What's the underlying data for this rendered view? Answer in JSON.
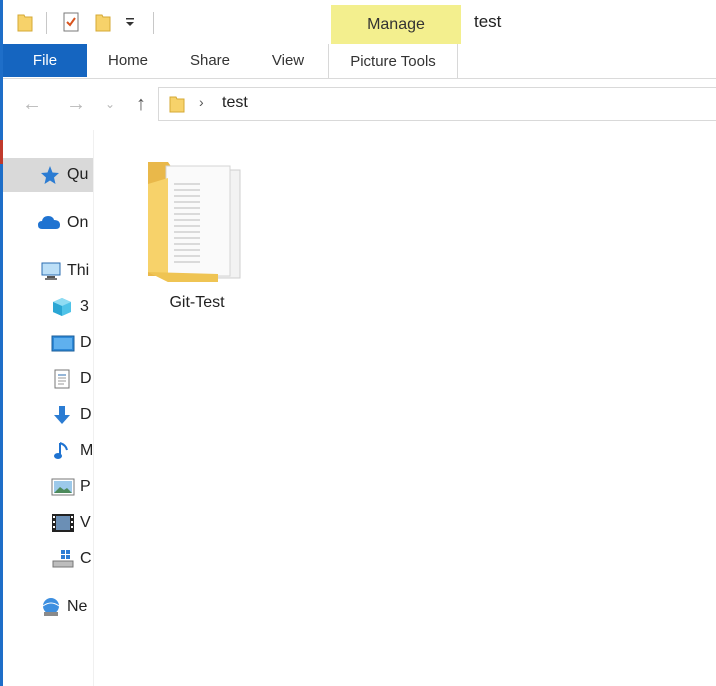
{
  "window": {
    "title": "test"
  },
  "quick_access_toolbar": {
    "items": [
      "folder-icon",
      "properties-icon",
      "new-folder-icon",
      "customize-dropdown-icon"
    ]
  },
  "ribbon": {
    "context_tab": "Manage",
    "tabs": [
      {
        "label": "File"
      },
      {
        "label": "Home"
      },
      {
        "label": "Share"
      },
      {
        "label": "View"
      },
      {
        "label": "Picture Tools"
      }
    ]
  },
  "address_bar": {
    "path": [
      "test"
    ]
  },
  "nav_pane": {
    "items": [
      {
        "label": "Qu",
        "icon": "star-icon",
        "selected": true
      },
      {
        "label": "On",
        "icon": "cloud-icon"
      },
      {
        "label": "Thi",
        "icon": "computer-icon"
      },
      {
        "label": "3",
        "icon": "cube-icon"
      },
      {
        "label": "D",
        "icon": "desktop-icon"
      },
      {
        "label": "D",
        "icon": "document-icon"
      },
      {
        "label": "D",
        "icon": "download-icon"
      },
      {
        "label": "M",
        "icon": "music-icon"
      },
      {
        "label": "P",
        "icon": "picture-icon"
      },
      {
        "label": "V",
        "icon": "video-icon"
      },
      {
        "label": "C",
        "icon": "drive-icon"
      },
      {
        "label": "Ne",
        "icon": "network-icon"
      }
    ]
  },
  "content": {
    "items": [
      {
        "name": "Git-Test",
        "type": "folder"
      }
    ]
  },
  "colors": {
    "file_tab": "#1565c0",
    "manage_tab": "#f3ef8e",
    "selected_nav": "#d9d9d9",
    "folder_yellow": "#f7d26a"
  }
}
